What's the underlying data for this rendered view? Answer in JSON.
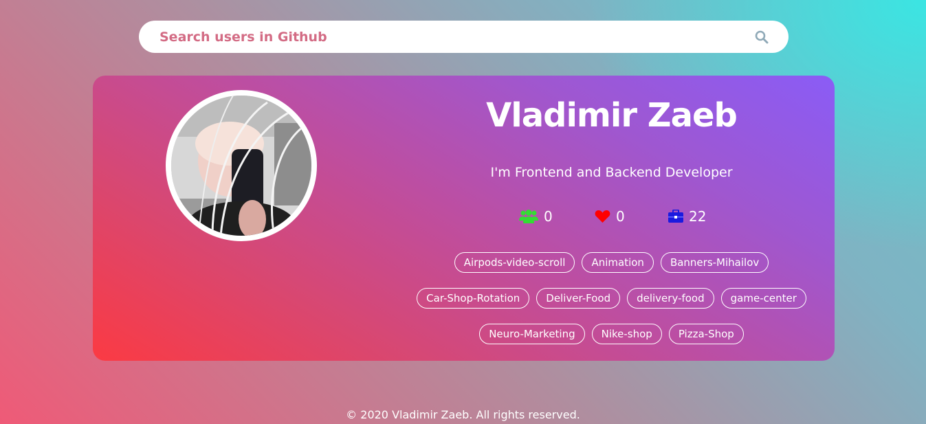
{
  "search": {
    "placeholder": "Search users in Github",
    "icon": "search-icon"
  },
  "profile": {
    "name": "Vladimir Zaeb",
    "bio": "I'm Frontend and Backend Developer",
    "stats": {
      "followers": {
        "icon": "users-icon",
        "value": "0",
        "color": "#33dd33"
      },
      "likes": {
        "icon": "heart-icon",
        "value": "0",
        "color": "#ff0000"
      },
      "repos": {
        "icon": "briefcase-icon",
        "value": "22",
        "color": "#1a1adf"
      }
    },
    "repositories": [
      "Airpods-video-scroll",
      "Animation",
      "Banners-Mihailov",
      "Car-Shop-Rotation",
      "Deliver-Food",
      "delivery-food",
      "game-center",
      "Neuro-Marketing",
      "Nike-shop",
      "Pizza-Shop"
    ]
  },
  "footer": {
    "text": "© 2020 Vladimir Zaeb. All rights reserved."
  }
}
